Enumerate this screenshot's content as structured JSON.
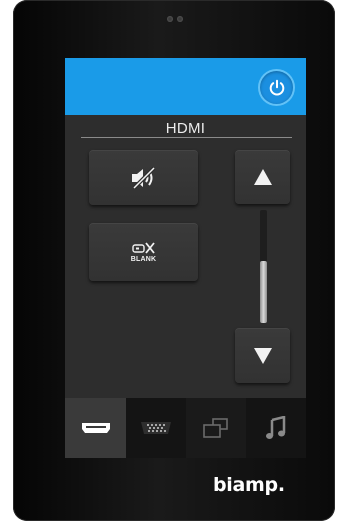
{
  "device": {
    "brand": "biamp."
  },
  "screen": {
    "source_title": "HDMI",
    "accent_color": "#1a9be8",
    "blank_label": "BLANK",
    "volume_level": 0.55,
    "selected_tab": "hdmi"
  },
  "icons": {
    "power": "power-icon",
    "mute": "speaker-mute-icon",
    "blank": "video-blank-icon",
    "volume_up": "triangle-up-icon",
    "volume_down": "triangle-down-icon",
    "hdmi": "hdmi-port-icon",
    "vga": "vga-port-icon",
    "multi": "multi-window-icon",
    "audio": "music-note-icon"
  }
}
